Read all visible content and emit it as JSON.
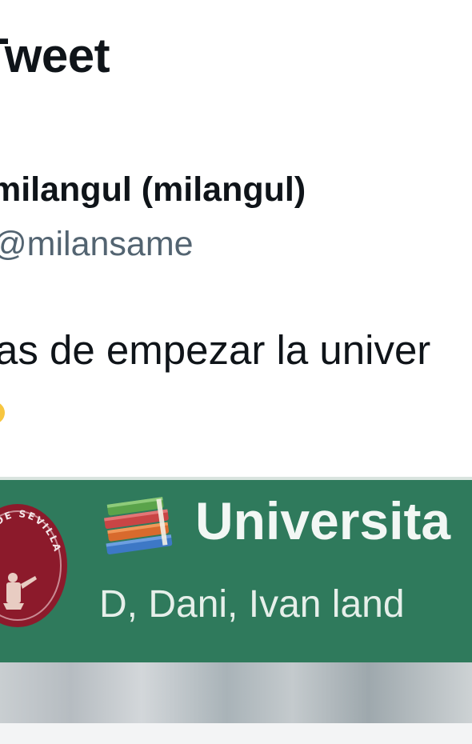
{
  "header": {
    "title": "Tweet"
  },
  "author": {
    "display_name": "milangul (milangul)",
    "handle": "@milansame"
  },
  "tweet": {
    "text": "as de empezar la univer"
  },
  "media": {
    "seal_text": "DAD DE SEVILLA",
    "group_title": "Universita",
    "group_members": "D, Dani, Ivan land",
    "icons": {
      "books": "books-emoji-icon",
      "seal": "university-seal-logo"
    }
  },
  "colors": {
    "text_primary": "#0f1419",
    "text_secondary": "#536471",
    "header_green": "#2f7a5c",
    "seal_maroon": "#8c1a2b"
  }
}
